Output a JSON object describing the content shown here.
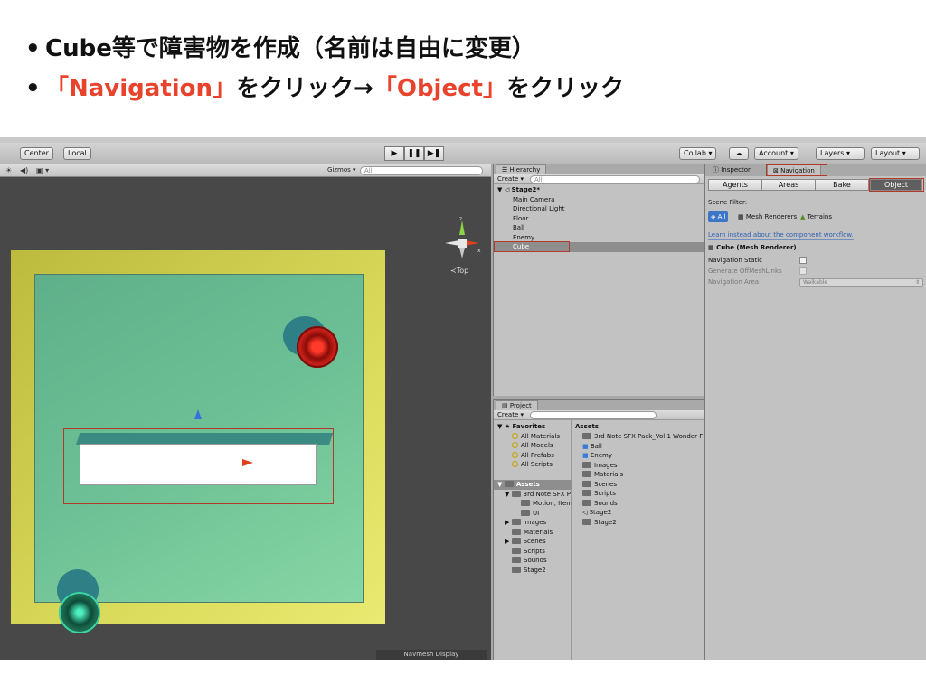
{
  "slide": {
    "bullet1": "Cube等で障害物を作成（名前は自由に変更）",
    "bullet2_red1": "「Navigation」",
    "bullet2_mid": "をクリック→",
    "bullet2_red2": "「Object」",
    "bullet2_end": "をクリック",
    "bullet_char": "•"
  },
  "toolbar": {
    "center": "Center",
    "local": "Local",
    "collab": "Collab ▾",
    "account": "Account ▾",
    "layers": "Layers",
    "layout": "Layout"
  },
  "scene": {
    "gizmos": "Gizmos ▾",
    "search_placeholder": "All",
    "top_label": "≺Top",
    "navmesh_display": "Navmesh Display",
    "axis_x": "x",
    "axis_z": "z"
  },
  "hierarchy": {
    "tab": "Hierarchy",
    "create": "Create ▾",
    "search_placeholder": "All",
    "scene_name": "Stage2*",
    "items": [
      "Main Camera",
      "Directional Light",
      "Floor",
      "Ball",
      "Enemy",
      "Cube"
    ],
    "selected": "Cube"
  },
  "project": {
    "tab": "Project",
    "create": "Create ▾",
    "favorites": "Favorites",
    "favorite_items": [
      "All Materials",
      "All Models",
      "All Prefabs",
      "All Scripts"
    ],
    "assets_label": "Assets",
    "tree": [
      "3rd Note SFX P",
      "Motion, Item",
      "UI",
      "Images",
      "Materials",
      "Scenes",
      "Scripts",
      "Sounds",
      "Stage2"
    ],
    "assets_header": "Assets",
    "asset_items": [
      "3rd Note SFX Pack_Vol.1 Wonder F",
      "Ball",
      "Enemy",
      "Images",
      "Materials",
      "Scenes",
      "Scripts",
      "Sounds",
      "Stage2",
      "Stage2"
    ]
  },
  "inspector": {
    "tab_inspector": "Inspector",
    "tab_navigation": "Navigation",
    "segments": [
      "Agents",
      "Areas",
      "Bake",
      "Object"
    ],
    "active_segment": "Object",
    "scene_filter": "Scene Filter:",
    "filter_all": "All",
    "filter_mesh": "Mesh Renderers",
    "filter_terrains": "Terrains",
    "learn_link": "Learn instead about the component workflow.",
    "component_title": "Cube (Mesh Renderer)",
    "navigation_static": "Navigation Static",
    "generate_offmesh": "Generate OffMeshLinks",
    "navigation_area": "Navigation Area",
    "area_value": "Walkable"
  },
  "colors": {
    "accent_red": "#e8432c",
    "highlight_box": "#b13a2b"
  }
}
